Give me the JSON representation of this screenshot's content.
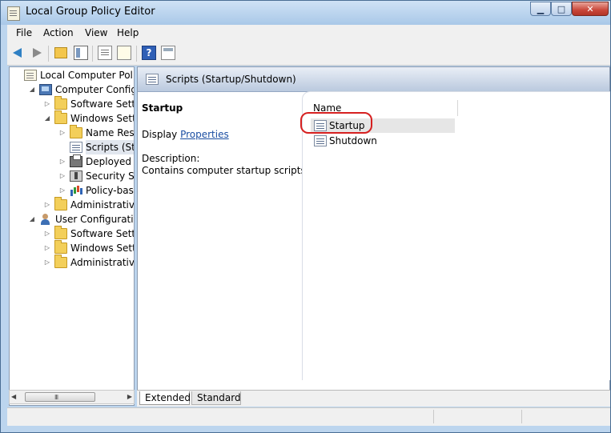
{
  "window": {
    "title": "Local Group Policy Editor"
  },
  "menu": [
    "File",
    "Action",
    "View",
    "Help"
  ],
  "tree": [
    {
      "label": "Local Computer Policy",
      "icon": "policy-doc-icon",
      "level": 0,
      "expander": ""
    },
    {
      "label": "Computer Configura",
      "icon": "computer-icon",
      "level": 1,
      "expander": "open"
    },
    {
      "label": "Software Settings",
      "icon": "folder-icon",
      "level": 2,
      "expander": "closed"
    },
    {
      "label": "Windows Setting",
      "icon": "folder-icon",
      "level": 2,
      "expander": "open"
    },
    {
      "label": "Name Resolu",
      "icon": "folder-icon",
      "level": 3,
      "expander": "closed"
    },
    {
      "label": "Scripts (Startu",
      "icon": "script-icon",
      "level": 3,
      "expander": "",
      "selected": true
    },
    {
      "label": "Deployed Pri",
      "icon": "printer-icon",
      "level": 3,
      "expander": "closed"
    },
    {
      "label": "Security Setti",
      "icon": "security-icon",
      "level": 3,
      "expander": "closed"
    },
    {
      "label": "Policy-based",
      "icon": "chart-icon",
      "level": 3,
      "expander": "closed"
    },
    {
      "label": "Administrative Te",
      "icon": "folder-icon",
      "level": 2,
      "expander": "closed"
    },
    {
      "label": "User Configuration",
      "icon": "user-icon",
      "level": 1,
      "expander": "open"
    },
    {
      "label": "Software Settings",
      "icon": "folder-icon",
      "level": 2,
      "expander": "closed"
    },
    {
      "label": "Windows Setting",
      "icon": "folder-icon",
      "level": 2,
      "expander": "closed"
    },
    {
      "label": "Administrative Te",
      "icon": "folder-icon",
      "level": 2,
      "expander": "closed"
    }
  ],
  "scrollbar": {
    "grip": "III"
  },
  "details": {
    "header_title": "Scripts (Startup/Shutdown)",
    "selected_title": "Startup",
    "display_prefix": "Display",
    "display_link": "Properties",
    "description_label": "Description:",
    "description": "Contains computer startup scripts."
  },
  "list": {
    "column_name": "Name",
    "items": [
      {
        "label": "Startup",
        "selected": true
      },
      {
        "label": "Shutdown",
        "selected": false
      }
    ]
  },
  "tabs": {
    "extended": "Extended",
    "standard": "Standard"
  },
  "colors": {
    "annotation": "#d62020",
    "link": "#1b4ea2",
    "header_band": "#bac9de"
  }
}
